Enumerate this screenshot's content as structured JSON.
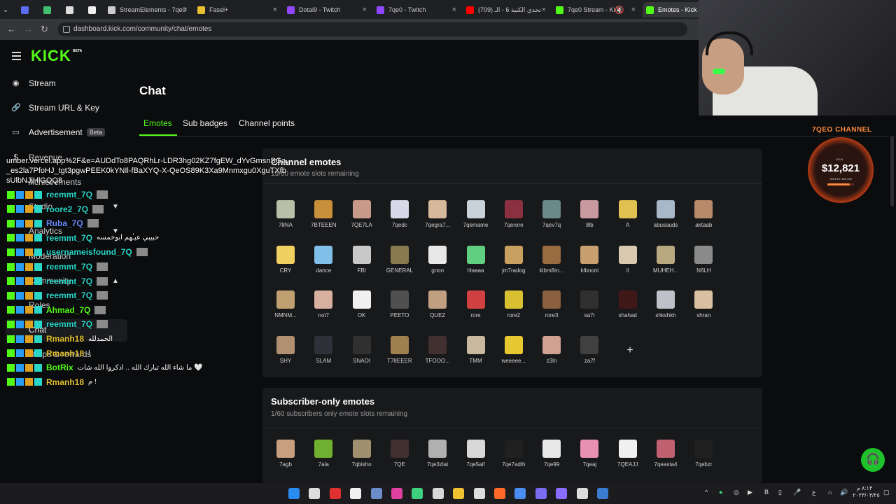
{
  "browser": {
    "tabs": [
      {
        "label": "StreamElements - 7qe0"
      },
      {
        "label": "Fasel+"
      },
      {
        "label": "Dotai9 - Twitch"
      },
      {
        "label": "7qe0 - Twitch"
      },
      {
        "label": "(709) تحدي الكنبة 6 - الـ"
      },
      {
        "label": "7qe0 Stream - Kic"
      },
      {
        "label": "Emotes - Kick Da"
      }
    ],
    "url": "dashboard.kick.com/community/chat/emotes"
  },
  "kick": {
    "logo": "KICK",
    "beta": "BETA"
  },
  "sidebar": {
    "items": [
      {
        "label": "Stream",
        "icon": "radio-icon"
      },
      {
        "label": "Stream URL & Key",
        "icon": "link-icon"
      },
      {
        "label": "Advertisement",
        "icon": "ad-icon",
        "badge": "Beta"
      },
      {
        "label": "Revenue",
        "icon": "dollar-icon"
      },
      {
        "label": "Achievements",
        "icon": "trophy-icon"
      },
      {
        "label": "Studio",
        "icon": "studio-icon"
      },
      {
        "label": "Analytics",
        "icon": "chart-icon"
      },
      {
        "label": "Moderation",
        "icon": "shield-icon"
      },
      {
        "label": "Community",
        "icon": "users-icon"
      },
      {
        "label": "Roles",
        "icon": ""
      },
      {
        "label": "Chat",
        "icon": ""
      },
      {
        "label": "Drops & rewards",
        "icon": ""
      }
    ]
  },
  "main": {
    "title": "Chat",
    "tabs": [
      {
        "label": "Emotes"
      },
      {
        "label": "Sub badges"
      },
      {
        "label": "Channel points"
      }
    ]
  },
  "channel_emotes": {
    "title": "Channel emotes",
    "subtitle": "15/60 emote slots remaining",
    "emotes": [
      {
        "name": "78NA",
        "color": "#b9c0a8"
      },
      {
        "name": "7BTEEEN",
        "color": "#c8903a"
      },
      {
        "name": "7QE7LA",
        "color": "#c79a8a"
      },
      {
        "name": "7qedc",
        "color": "#d8d8e8"
      },
      {
        "name": "7qegra7...",
        "color": "#d6b89a"
      },
      {
        "name": "7qemame",
        "color": "#c8d0d8"
      },
      {
        "name": "7qerore",
        "color": "#8a3040"
      },
      {
        "name": "7qev7q",
        "color": "#6a8a8a"
      },
      {
        "name": "8lb",
        "color": "#c89aa0"
      },
      {
        "name": "A",
        "color": "#e0c050"
      },
      {
        "name": "abusauds",
        "color": "#a8b8c8"
      },
      {
        "name": "aktaab",
        "color": "#b88a6a"
      },
      {
        "name": "CRY",
        "color": "#f0d060"
      },
      {
        "name": "dance",
        "color": "#80c0e8"
      },
      {
        "name": "FBI",
        "color": "#c8c8c8"
      },
      {
        "name": "GENERAL",
        "color": "#8a7a50"
      },
      {
        "name": "gnon",
        "color": "#e8e8e8"
      },
      {
        "name": "hlaaaa",
        "color": "#60d080"
      },
      {
        "name": "jm7radog",
        "color": "#c8a060"
      },
      {
        "name": "klbm8m...",
        "color": "#9a6a40"
      },
      {
        "name": "klbnoni",
        "color": "#c8a070"
      },
      {
        "name": "ll",
        "color": "#d8c8b0"
      },
      {
        "name": "MUHEH...",
        "color": "#b8a880"
      },
      {
        "name": "N6LH",
        "color": "#8a8a8a"
      },
      {
        "name": "NMNM...",
        "color": "#c0a070"
      },
      {
        "name": "not7",
        "color": "#d8b0a0"
      },
      {
        "name": "OK",
        "color": "#f0f0f0"
      },
      {
        "name": "PEETO",
        "color": "#505050"
      },
      {
        "name": "QUEZ",
        "color": "#c0a080"
      },
      {
        "name": "rore",
        "color": "#d04040"
      },
      {
        "name": "rore2",
        "color": "#d8c030"
      },
      {
        "name": "rore3",
        "color": "#8a6040"
      },
      {
        "name": "sa7r",
        "color": "#303030"
      },
      {
        "name": "shahad",
        "color": "#401818"
      },
      {
        "name": "shkshkh",
        "color": "#c0c0c8"
      },
      {
        "name": "shran",
        "color": "#d8c0a0"
      },
      {
        "name": "SHY",
        "color": "#b09070"
      },
      {
        "name": "SLAM",
        "color": "#303038"
      },
      {
        "name": "SNAOI",
        "color": "#303030"
      },
      {
        "name": "T78EEER",
        "color": "#a08050"
      },
      {
        "name": "TFOOO...",
        "color": "#403030"
      },
      {
        "name": "TMM",
        "color": "#c8b8a0"
      },
      {
        "name": "weeeee...",
        "color": "#e8c830"
      },
      {
        "name": "z3ln",
        "color": "#d0a090"
      },
      {
        "name": "za7f",
        "color": "#404040"
      }
    ]
  },
  "subscriber_emotes": {
    "title": "Subscriber-only emotes",
    "subtitle": "1/60 subscribers only emote slots remaining",
    "emotes": [
      {
        "name": "7agb",
        "color": "#c8a080"
      },
      {
        "name": "7ala",
        "color": "#70b030"
      },
      {
        "name": "7qbisho",
        "color": "#a09070"
      },
      {
        "name": "7QE",
        "color": "#403030"
      },
      {
        "name": "7qe3zlat",
        "color": "#b0b0b0"
      },
      {
        "name": "7qe5aif",
        "color": "#d8d8d8"
      },
      {
        "name": "7qe7adth",
        "color": "#202020"
      },
      {
        "name": "7qe99",
        "color": "#e8e8e8"
      },
      {
        "name": "7qeaj",
        "color": "#e890b0"
      },
      {
        "name": "7QEAJJ",
        "color": "#f0f0f0"
      },
      {
        "name": "7qeasta4",
        "color": "#c06070"
      },
      {
        "name": "7qebzr",
        "color": "#202020"
      }
    ]
  },
  "overlay": {
    "url_text": "umber.vercel.app%2F&e=AUDdTo8PAQRhLr-LDR3hg02KZ7fgEW_dYvGmsnSGa_es2la7PfoHJ_tgt3pgwPEEK0kYNIl-fBaXYQ-X-QeOS89K3Xa9Mnmxgu0XguTXfbsUlbNJjHlGQQ8",
    "chat": [
      {
        "user": "reemmt_7Q",
        "color": "#29d6c8",
        "msg": ""
      },
      {
        "user": "roore2_7Q",
        "color": "#29d6c8",
        "msg": ""
      },
      {
        "user": "Ruba_7Q",
        "color": "#6b8cff",
        "msg": ""
      },
      {
        "user": "reemmt_7Q",
        "color": "#29d6c8",
        "msg": "حبيبي عيـٰهم ابوخمسه"
      },
      {
        "user": "usernameisfound_7Q",
        "color": "#29d6c8",
        "msg": ""
      },
      {
        "user": "reemmt_7Q",
        "color": "#29d6c8",
        "msg": ""
      },
      {
        "user": "reemmt_7Q",
        "color": "#29d6c8",
        "msg": ""
      },
      {
        "user": "reemmt_7Q",
        "color": "#29d6c8",
        "msg": ""
      },
      {
        "user": "Ahmad_7Q",
        "color": "#53fc18",
        "msg": ""
      },
      {
        "user": "reemmt_7Q",
        "color": "#29d6c8",
        "msg": ""
      },
      {
        "user": "Rmanh18",
        "color": "#e0c030",
        "msg": "الحمدلله"
      },
      {
        "user": "Rmanh18",
        "color": "#e0c030",
        "msg": "!"
      },
      {
        "user": "BotRix",
        "color": "#53fc18",
        "msg": "ما شاء الله تبارك الله .. اذكروا الله شات 🤍"
      },
      {
        "user": "Rmanh18",
        "color": "#e0c030",
        "msg": "م !"
      }
    ]
  },
  "goal": {
    "title": "7QEO CHANNEL",
    "label": "GOAL",
    "amount": "$12,821",
    "target": "TARGET: $15,000",
    "progress": 0.85
  },
  "taskbar": {
    "time": "٨:١٣ م",
    "date": "٢٠٢٣/٠٣/٢٥"
  },
  "colors": {
    "accent": "#53fc18",
    "background": "#0b0c0e",
    "card": "#18191b"
  }
}
